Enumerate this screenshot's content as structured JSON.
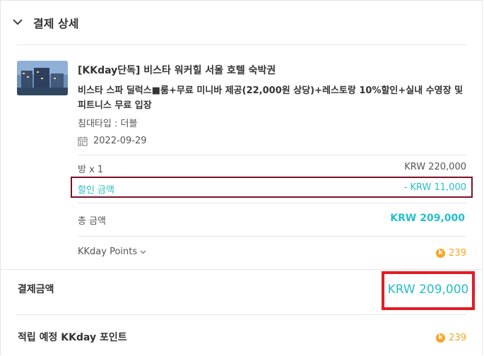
{
  "header": {
    "title": "결제 상세",
    "icon": "chevron-down-icon"
  },
  "product": {
    "title": "[KKday단독] 비스타 워커힐 서울 호텔 숙박권",
    "subtitle": "비스타 스파 딜럭스■룸+무료 미니바 제공(22,000원 상당)+레스토랑 10%할인+실내 수영장 및 피트니스 무료 입장",
    "bed_type": "침대타입 : 더블",
    "date": "2022-09-29"
  },
  "price_rows": {
    "room_label": "방 x 1",
    "room_value": "KRW 220,000",
    "discount_label": "할인 금액",
    "discount_value": "- KRW 11,000",
    "total_label": "총 금액",
    "total_value": "KRW 209,000"
  },
  "points": {
    "toggle_label": "KKday Points",
    "coin_symbol": "k",
    "value": "239"
  },
  "payment": {
    "label": "결제금액",
    "amount": "KRW 209,000"
  },
  "earn": {
    "label": "적립 예정 KKday 포인트",
    "coin_symbol": "k",
    "value": "239"
  },
  "colors": {
    "accent": "#26bec9",
    "points": "#f5a623",
    "highlight_red": "#e31b23",
    "highlight_maroon": "#7a1126"
  }
}
